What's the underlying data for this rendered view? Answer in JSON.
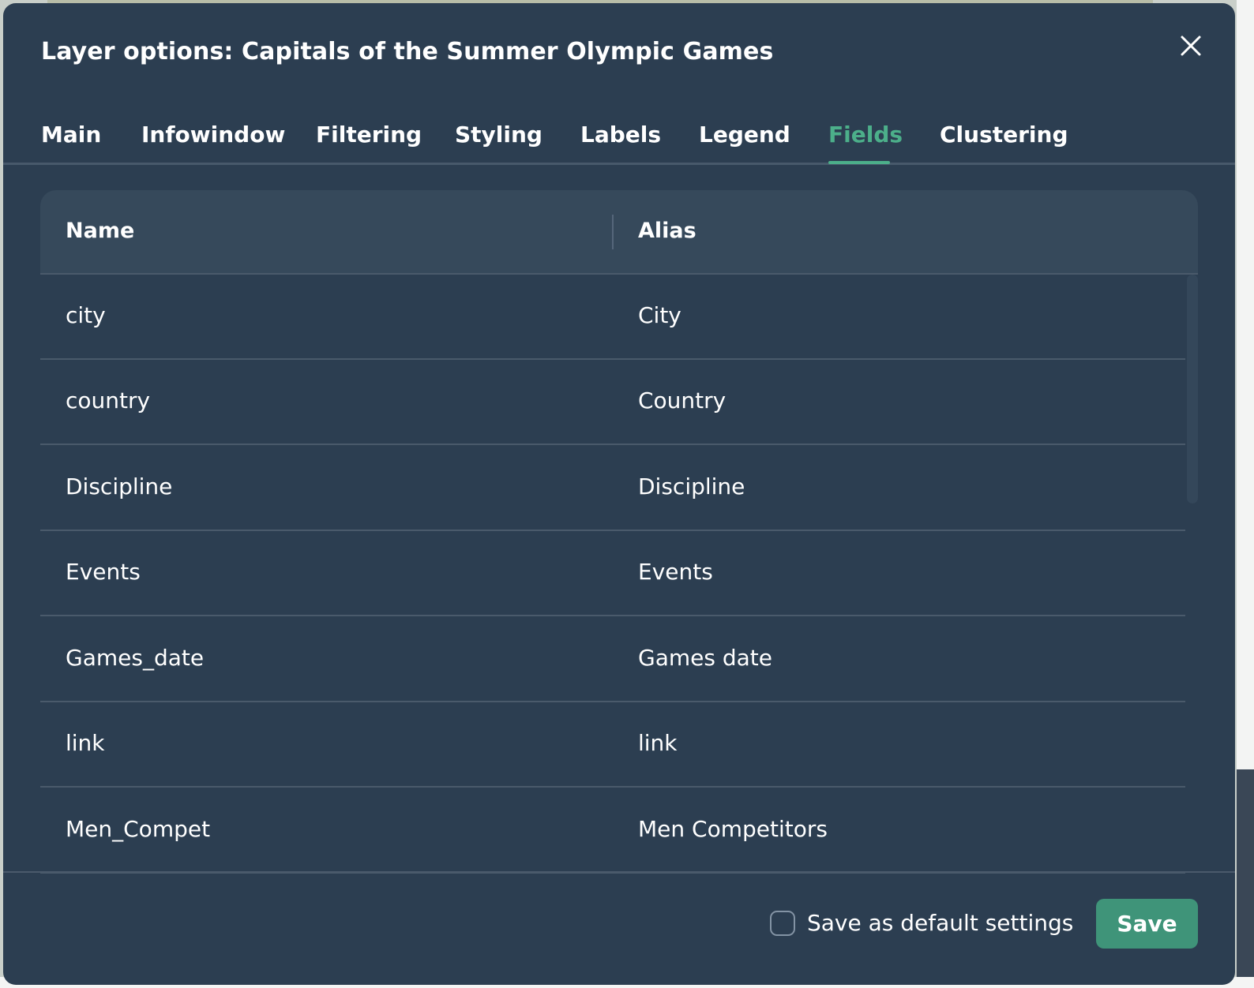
{
  "dialog": {
    "title": "Layer options: Capitals of the Summer Olympic Games",
    "close_icon": "close-icon"
  },
  "tabs": [
    {
      "label": "Main"
    },
    {
      "label": "Infowindow"
    },
    {
      "label": "Filtering"
    },
    {
      "label": "Styling"
    },
    {
      "label": "Labels"
    },
    {
      "label": "Legend"
    },
    {
      "label": "Fields",
      "active": true
    },
    {
      "label": "Clustering"
    }
  ],
  "table": {
    "headers": {
      "name": "Name",
      "alias": "Alias"
    },
    "rows": [
      {
        "name": "city",
        "alias": "City"
      },
      {
        "name": "country",
        "alias": "Country"
      },
      {
        "name": "Discipline",
        "alias": "Discipline"
      },
      {
        "name": "Events",
        "alias": "Events"
      },
      {
        "name": "Games_date",
        "alias": "Games date"
      },
      {
        "name": "link",
        "alias": "link"
      },
      {
        "name": "Men_Compet",
        "alias": "Men Competitors"
      }
    ]
  },
  "footer": {
    "checkbox_label": "Save as default settings",
    "checkbox_checked": false,
    "save_label": "Save"
  },
  "colors": {
    "dialog_bg": "#2c3e51",
    "accent": "#4caf8a",
    "save_button": "#3f9479"
  }
}
